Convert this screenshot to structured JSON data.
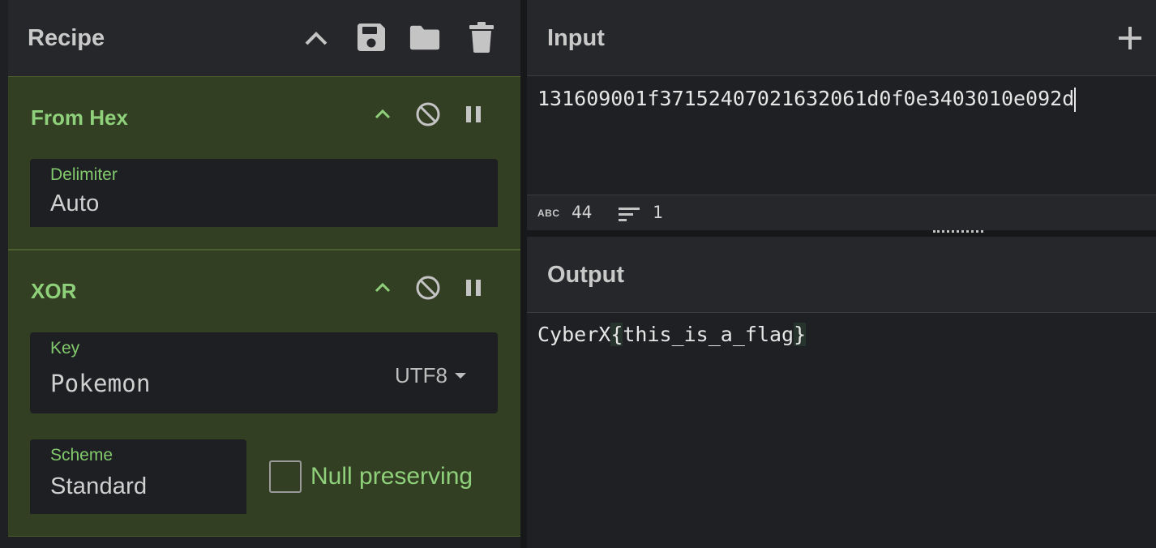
{
  "recipe": {
    "title": "Recipe",
    "operations": [
      {
        "name": "From Hex",
        "fields": [
          {
            "label": "Delimiter",
            "value": "Auto"
          }
        ]
      },
      {
        "name": "XOR",
        "key": {
          "label": "Key",
          "value": "Pokemon",
          "encoding": "UTF8"
        },
        "scheme": {
          "label": "Scheme",
          "value": "Standard"
        },
        "null_preserving": {
          "label": "Null preserving",
          "checked": false
        }
      }
    ]
  },
  "input": {
    "title": "Input",
    "text": "131609001f37152407021632061d0f0e3403010e092d",
    "status": {
      "abc_label": "ABC",
      "length": "44",
      "lines": "1"
    }
  },
  "output": {
    "title": "Output",
    "prefix": "CyberX",
    "open_brace": "{",
    "inner": "this_is_a_flag",
    "close_brace": "}"
  },
  "colors": {
    "op_background": "#323f23",
    "op_label_green": "#8fd17a",
    "panel_header": "#26272a"
  }
}
